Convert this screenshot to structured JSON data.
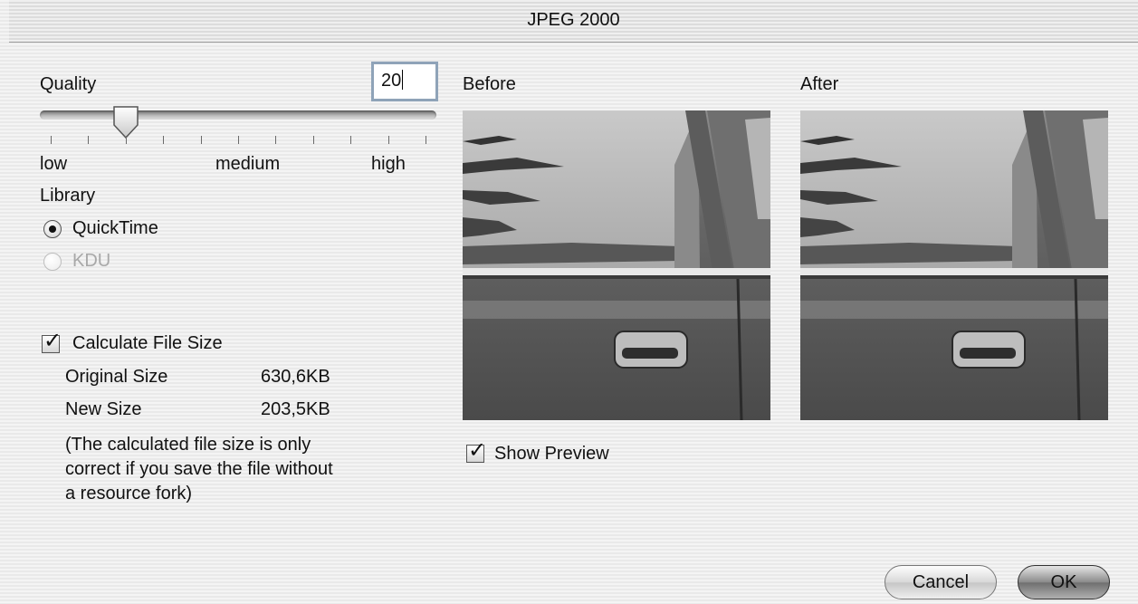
{
  "window": {
    "title": "JPEG 2000"
  },
  "quality": {
    "label": "Quality",
    "value": "20",
    "slider_level": 0.2,
    "tick_count": 11,
    "low_label": "low",
    "medium_label": "medium",
    "high_label": "high"
  },
  "library": {
    "label": "Library",
    "options": [
      {
        "label": "QuickTime",
        "selected": true,
        "enabled": true
      },
      {
        "label": "KDU",
        "selected": false,
        "enabled": false
      }
    ]
  },
  "file_size": {
    "checkbox_label": "Calculate File Size",
    "checked": true,
    "original_label": "Original Size",
    "original_value": "630,6KB",
    "new_label": "New Size",
    "new_value": "203,5KB",
    "note_lines": [
      "(The calculated file size is only",
      "correct if you save the file without",
      "a resource fork)"
    ]
  },
  "preview": {
    "before_label": "Before",
    "after_label": "After",
    "show_preview_label": "Show Preview",
    "show_preview_checked": true
  },
  "buttons": {
    "cancel": "Cancel",
    "ok": "OK"
  },
  "icons": {
    "slider_thumb": "slider-thumb-icon",
    "radio_selected": "radio-selected-icon",
    "checkmark": "checkmark-icon"
  }
}
